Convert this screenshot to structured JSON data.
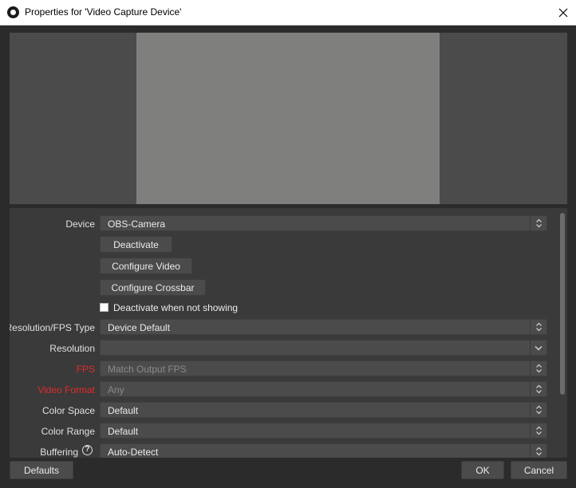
{
  "window": {
    "title": "Properties for 'Video Capture Device'",
    "icon": "obs-icon"
  },
  "properties": {
    "device": {
      "label": "Device",
      "value": "OBS-Camera"
    },
    "buttons": {
      "deactivate": "Deactivate",
      "configure_video": "Configure Video",
      "configure_crossbar": "Configure Crossbar"
    },
    "deactivate_when_not_showing": {
      "label": "Deactivate when not showing",
      "checked": false
    },
    "resolution_fps_type": {
      "label": "Resolution/FPS Type",
      "value": "Device Default"
    },
    "resolution": {
      "label": "Resolution",
      "value": ""
    },
    "fps": {
      "label": "FPS",
      "value": "Match Output FPS"
    },
    "video_format": {
      "label": "Video Format",
      "value": "Any"
    },
    "color_space": {
      "label": "Color Space",
      "value": "Default"
    },
    "color_range": {
      "label": "Color Range",
      "value": "Default"
    },
    "buffering": {
      "label": "Buffering",
      "value": "Auto-Detect"
    }
  },
  "footer": {
    "defaults": "Defaults",
    "ok": "OK",
    "cancel": "Cancel"
  },
  "colors": {
    "background": "#2b2b2b",
    "panel": "#3a3a3a",
    "control": "#4b4b4b",
    "preview_video": "#7f807e",
    "warning_label": "#e22b2b"
  }
}
